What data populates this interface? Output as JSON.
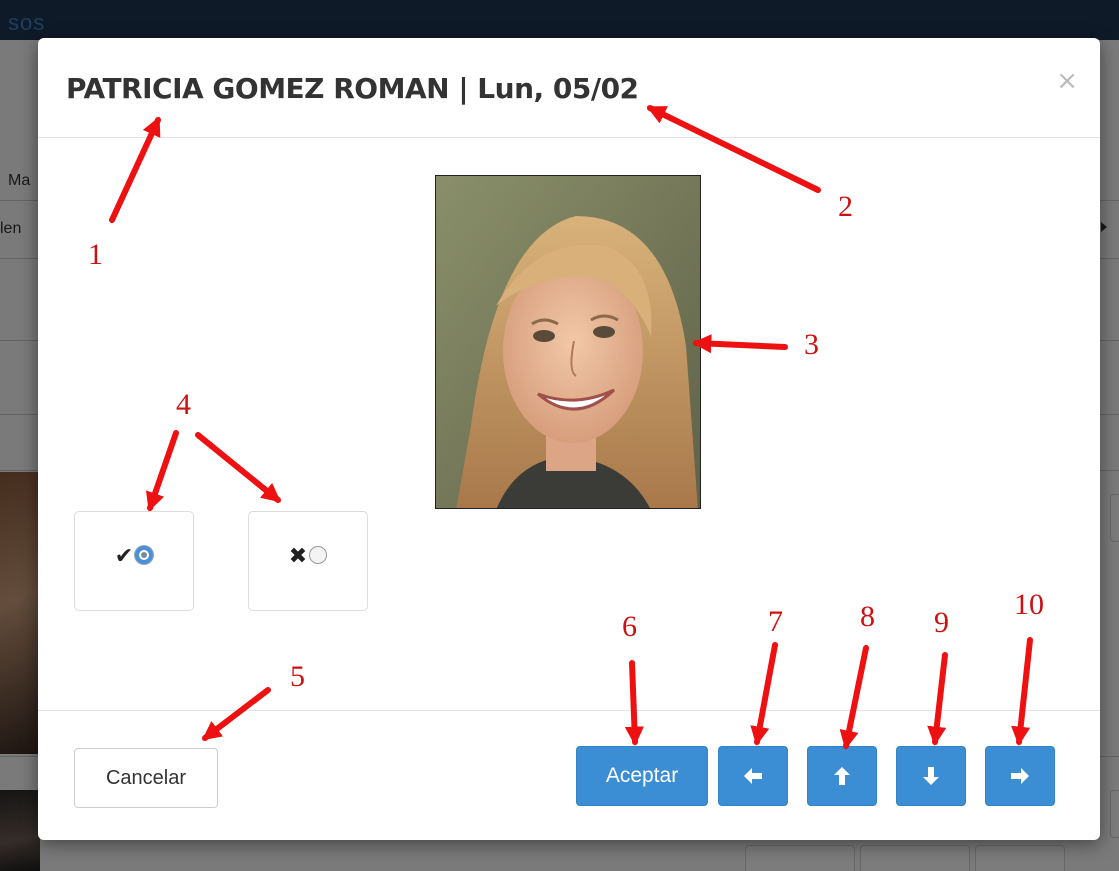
{
  "background": {
    "app_title": "sos",
    "fragment_1": "Ma",
    "fragment_2": "len"
  },
  "modal": {
    "title": "PATRICIA GOMEZ ROMAN | Lun, 05/02",
    "close_glyph": "×",
    "photo_icon": "portrait-photo",
    "present_option": {
      "icon": "check-icon",
      "glyph": "✔",
      "selected": true
    },
    "absent_option": {
      "icon": "cross-icon",
      "glyph": "✖",
      "selected": false
    },
    "footer": {
      "cancel_label": "Cancelar",
      "accept_label": "Aceptar",
      "nav_left_glyph": "🡐",
      "nav_up_glyph": "🡑",
      "nav_down_glyph": "🡓",
      "nav_right_glyph": "🡒"
    }
  },
  "colors": {
    "primary": "#3c8ed4",
    "annotation": "#ee1111",
    "topbar": "#1f3550"
  },
  "annotations": {
    "label_1": "1",
    "label_2": "2",
    "label_3": "3",
    "label_4": "4",
    "label_5": "5",
    "label_6": "6",
    "label_7": "7",
    "label_8": "8",
    "label_9": "9",
    "label_10": "10"
  }
}
